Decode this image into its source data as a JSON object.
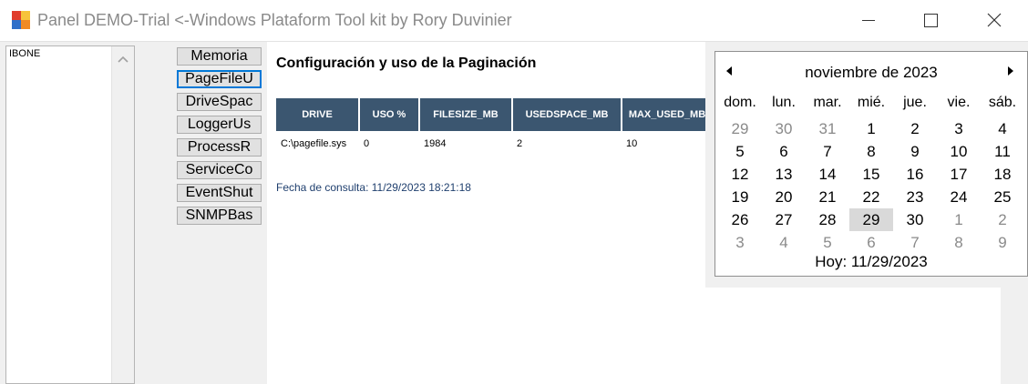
{
  "window": {
    "title": "Panel DEMO-Trial <-Windows Plataform Tool kit by Rory Duvinier"
  },
  "left_list": {
    "items": [
      "IBONE"
    ]
  },
  "nav_buttons": [
    "Memoria",
    "PageFileU",
    "DriveSpac",
    "LoggerUs",
    "ProcessR",
    "ServiceCo",
    "EventShut",
    "SNMPBas"
  ],
  "content": {
    "title": "Configuración y uso de la Paginación",
    "table": {
      "headers": [
        "DRIVE",
        "USO %",
        "FILESIZE_MB",
        "USEDSPACE_MB",
        "MAX_USED_MB"
      ],
      "rows": [
        [
          "C:\\pagefile.sys",
          "0",
          "1984",
          "2",
          "10"
        ]
      ]
    },
    "fecha": "Fecha de consulta: 11/29/2023 18:21:18"
  },
  "calendar": {
    "month": "noviembre de 2023",
    "day_headers": [
      "dom.",
      "lun.",
      "mar.",
      "mié.",
      "jue.",
      "vie.",
      "sáb."
    ],
    "weeks": [
      [
        "29",
        "30",
        "31",
        "1",
        "2",
        "3",
        "4"
      ],
      [
        "5",
        "6",
        "7",
        "8",
        "9",
        "10",
        "11"
      ],
      [
        "12",
        "13",
        "14",
        "15",
        "16",
        "17",
        "18"
      ],
      [
        "19",
        "20",
        "21",
        "22",
        "23",
        "24",
        "25"
      ],
      [
        "26",
        "27",
        "28",
        "29",
        "30",
        "1",
        "2"
      ],
      [
        "3",
        "4",
        "5",
        "6",
        "7",
        "8",
        "9"
      ]
    ],
    "today_day": "29",
    "footer": "Hoy: 11/29/2023"
  },
  "colors": {
    "header_bg": "#3b5670",
    "date_text": "#1f3f6e",
    "focus_border": "#0078d7",
    "today_highlight": "#d9d9d9"
  }
}
